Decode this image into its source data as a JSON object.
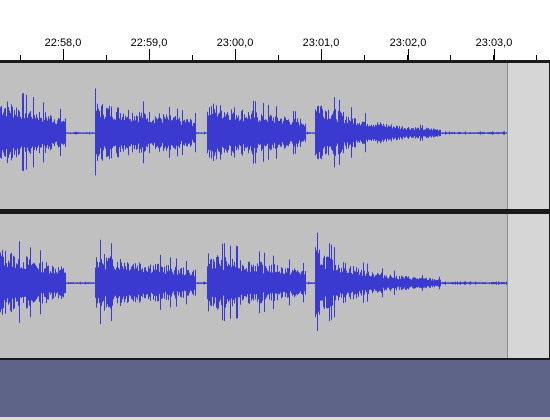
{
  "timeline": {
    "labels": [
      "22:58,0",
      "22:59,0",
      "23:00,0",
      "23:01,0",
      "23:02,0",
      "23:03,0"
    ]
  },
  "track": {
    "waveform_color": "#3a3ad0",
    "background_color": "#c0c0c0",
    "beyond_color": "#d6d6d6"
  },
  "empty_area_color": "#5e6487"
}
